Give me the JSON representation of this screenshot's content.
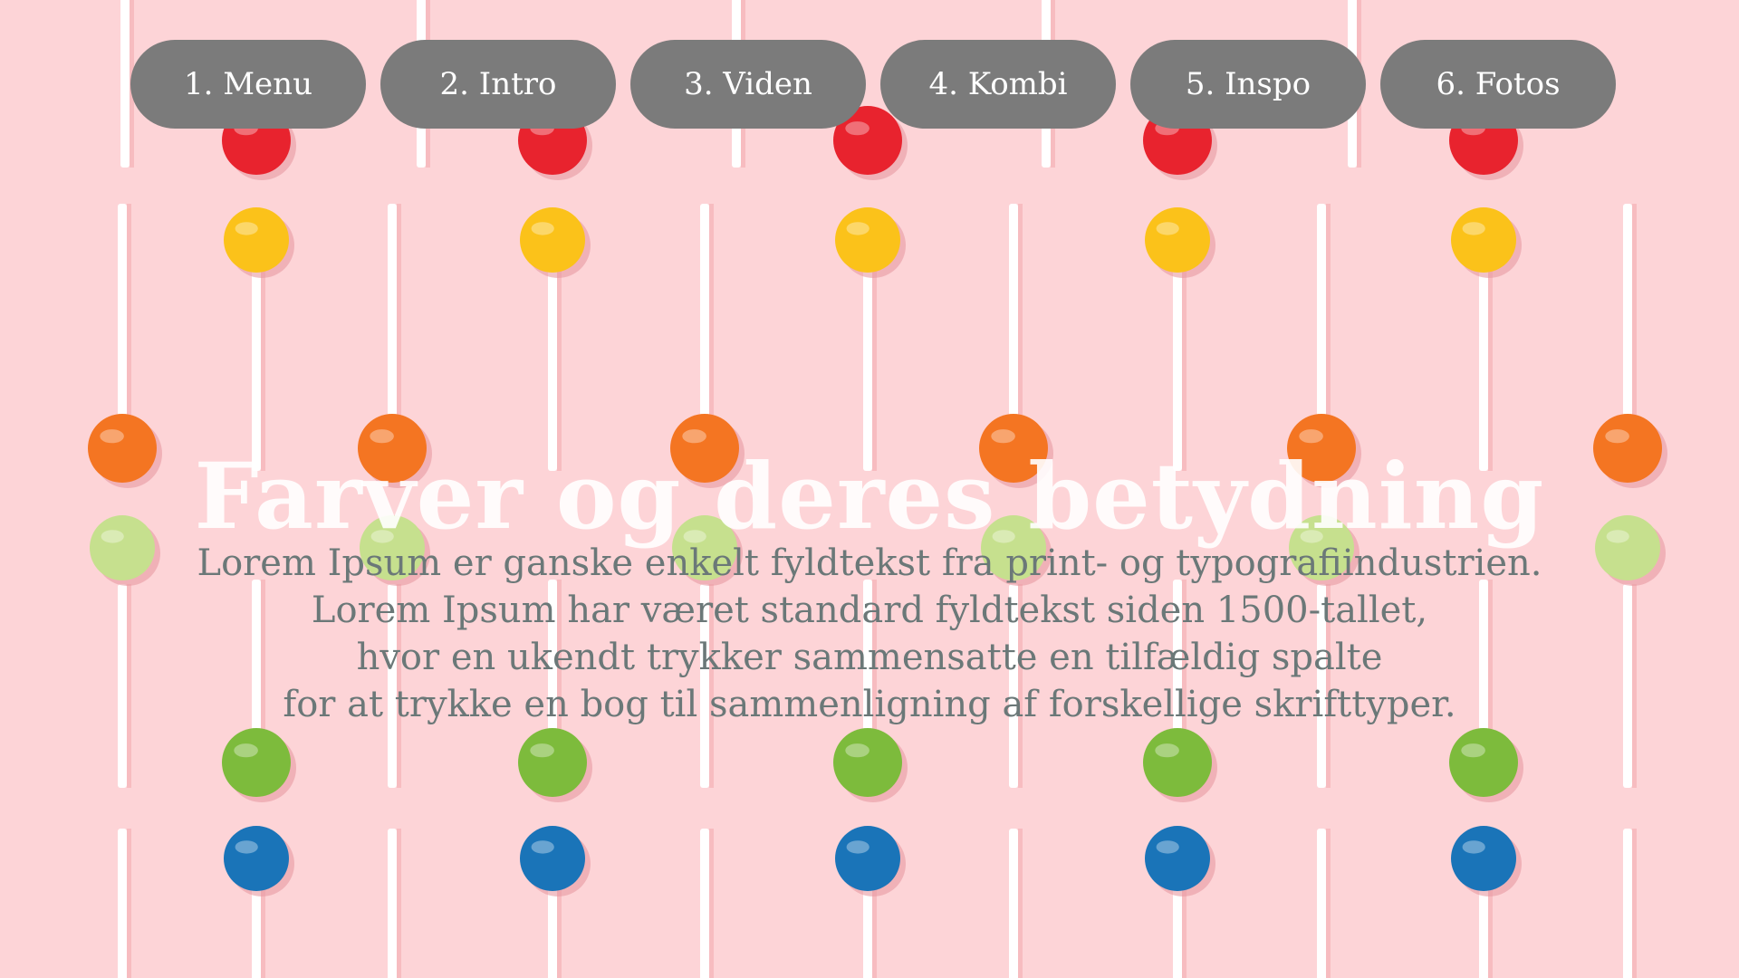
{
  "nav": {
    "items": [
      {
        "label": "1. Menu"
      },
      {
        "label": "2. Intro"
      },
      {
        "label": "3. Viden"
      },
      {
        "label": "4. Kombi"
      },
      {
        "label": "5. Inspo"
      },
      {
        "label": "6. Fotos"
      }
    ],
    "button_color": "#7b7b7b"
  },
  "hero": {
    "title": "Farver og deres betydning",
    "body_lines": [
      "Lorem Ipsum er ganske enkelt fyldtekst fra print- og typografiindustrien.",
      "Lorem Ipsum har været standard fyldtekst siden 1500-tallet,",
      "hvor en ukendt trykker sammensatte en tilfældig spalte",
      "for at trykke en bog til sammenligning af forskellige skrifttyper."
    ]
  },
  "background": {
    "description_colors": {
      "pink": "#fdd4d7",
      "red": "#e8232e",
      "yellow": "#fbc21a",
      "orange": "#f47522",
      "light_green": "#c6e08e",
      "green": "#7dbb3c",
      "blue": "#1a74b8",
      "stick": "#ffffff"
    }
  }
}
